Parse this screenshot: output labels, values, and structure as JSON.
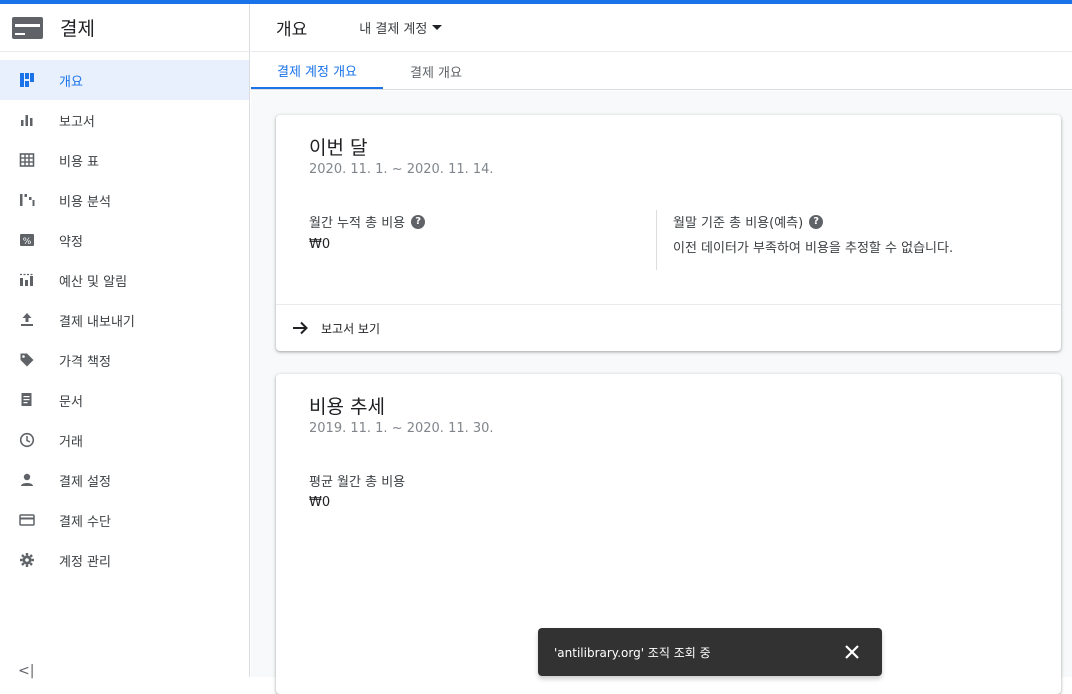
{
  "app": {
    "title": "결제"
  },
  "sidebar": {
    "items": [
      {
        "label": "개요",
        "icon": "dashboard-icon",
        "active": true
      },
      {
        "label": "보고서",
        "icon": "bar-chart-icon"
      },
      {
        "label": "비용 표",
        "icon": "table-icon"
      },
      {
        "label": "비용 분석",
        "icon": "waterfall-chart-icon"
      },
      {
        "label": "약정",
        "icon": "percent-icon"
      },
      {
        "label": "예산 및 알림",
        "icon": "budget-icon"
      },
      {
        "label": "결제 내보내기",
        "icon": "upload-icon"
      },
      {
        "label": "가격 책정",
        "icon": "tag-icon"
      },
      {
        "label": "문서",
        "icon": "document-icon"
      },
      {
        "label": "거래",
        "icon": "clock-icon"
      },
      {
        "label": "결제 설정",
        "icon": "person-icon"
      },
      {
        "label": "결제 수단",
        "icon": "credit-card-icon"
      },
      {
        "label": "계정 관리",
        "icon": "gear-icon"
      }
    ],
    "collapse": "<|"
  },
  "header": {
    "title": "개요",
    "account_select": "내 결제 계정"
  },
  "tabs": [
    {
      "label": "결제 계정 개요",
      "active": true
    },
    {
      "label": "결제 개요"
    }
  ],
  "card_this_month": {
    "title": "이번 달",
    "date_range": "2020. 11. 1. ~ 2020. 11. 14.",
    "left_label": "월간 누적 총 비용",
    "left_value": "₩0",
    "right_label": "월말 기준 총 비용(예측)",
    "right_value": "이전 데이터가 부족하여 비용을 추정할 수 없습니다.",
    "footer_link": "보고서 보기"
  },
  "card_trend": {
    "title": "비용 추세",
    "date_range": "2019. 11. 1. ~ 2020. 11. 30.",
    "label": "평균 월간 총 비용",
    "value": "₩0"
  },
  "snackbar": {
    "message": "'antilibrary.org' 조직 조회 중"
  },
  "colors": {
    "accent": "#1a73e8",
    "active_bg": "#e8f0fe",
    "snackbar_bg": "#323232"
  }
}
